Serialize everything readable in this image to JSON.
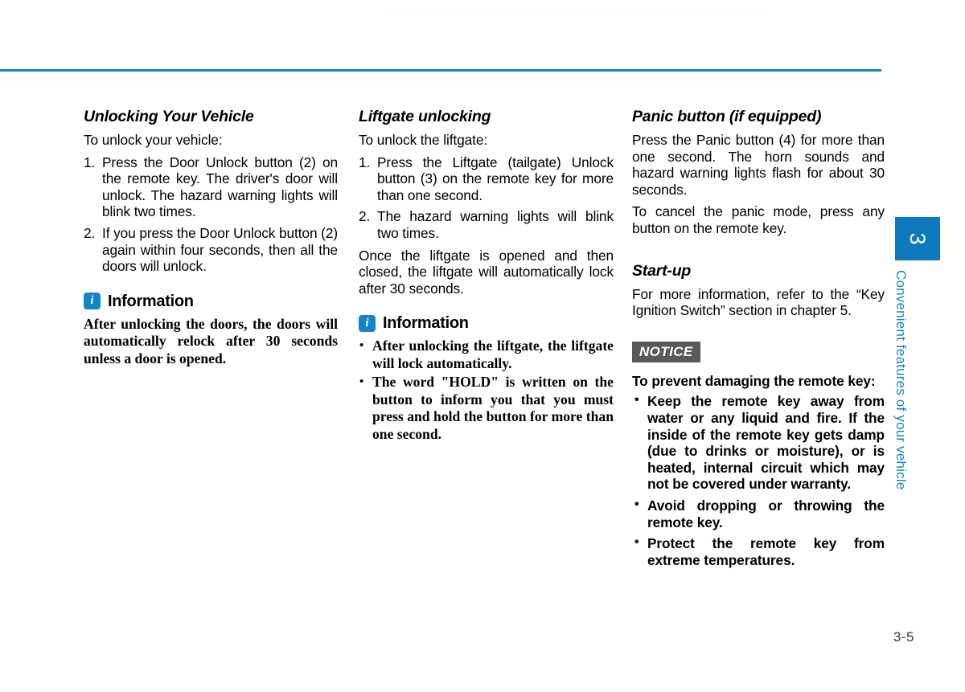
{
  "page": {
    "number": "3-5",
    "accent_blue": "#1d7fc0",
    "icon_blue": "#1484c8",
    "notice_gray": "#595959"
  },
  "sidebar": {
    "chapter_number": "3",
    "chapter_title": "Convenient features of your vehicle"
  },
  "columns": {
    "left": {
      "heading": "Unlocking Your Vehicle",
      "intro": "To unlock your vehicle:",
      "steps": [
        {
          "num": "1.",
          "text": "Press the Door Unlock button (2) on the remote key.  The driver's door will unlock.  The hazard warning lights will blink two times."
        },
        {
          "num": "2.",
          "text": "If you press the Door Unlock button (2) again within four seconds, then all the doors will unlock."
        }
      ],
      "info": {
        "icon": "info-icon",
        "title": "Information",
        "body": "After unlocking the doors, the doors will automatically relock after 30 seconds unless a door is opened."
      }
    },
    "middle": {
      "heading": "Liftgate unlocking",
      "intro": "To unlock the liftgate:",
      "steps": [
        {
          "num": "1.",
          "text": "Press the Liftgate (tailgate) Unlock button (3) on the remote key for more than one second."
        },
        {
          "num": "2.",
          "text": "The hazard warning lights will blink two times."
        }
      ],
      "closing": "Once the liftgate is opened and then closed, the liftgate will automatically lock after 30 seconds.",
      "info": {
        "icon": "info-icon",
        "title": "Information",
        "bullets": [
          "After unlocking the liftgate, the liftgate will lock automatically.",
          "The word \"HOLD\" is written on the button to inform you that you must press and hold the button for more than one second."
        ]
      }
    },
    "right": {
      "panic": {
        "heading": "Panic button (if equipped)",
        "paragraphs": [
          "Press the Panic button (4) for more than one second. The horn sounds and hazard warning lights flash for about 30 seconds.",
          "To cancel the panic mode, press any button on the remote key."
        ]
      },
      "startup": {
        "heading": "Start-up",
        "paragraph": "For more information, refer to the “Key Ignition Switch” section in chapter 5."
      },
      "notice": {
        "badge": "NOTICE",
        "lead": "To prevent damaging the remote key:",
        "bullets": [
          "Keep the remote key away from water or any liquid and fire. If the inside of the remote key gets damp (due to drinks or moisture), or is heated, internal circuit which may not be covered under warranty.",
          "Avoid dropping or throwing the remote key.",
          "Protect the remote key from extreme temperatures."
        ]
      }
    }
  }
}
